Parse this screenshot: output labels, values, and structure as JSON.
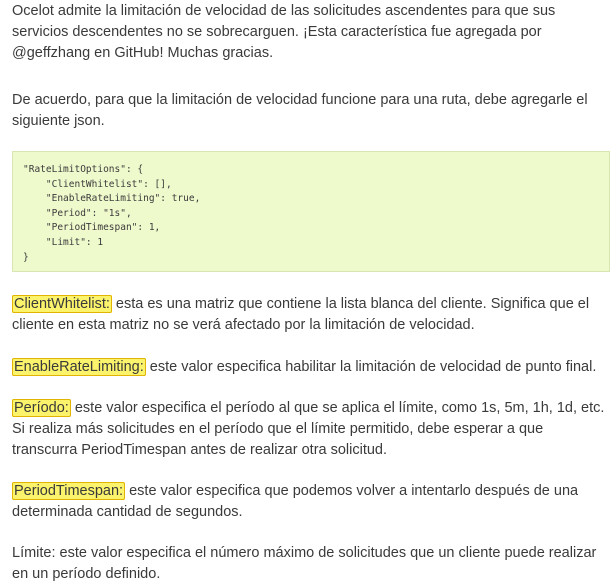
{
  "intro": "Ocelot admite la limitación de velocidad de las solicitudes ascendentes para que sus servicios descendentes no se sobrecarguen. ¡Esta característica fue agregada por @geffzhang en GitHub! Muchas gracias.",
  "instruction": "De acuerdo, para que la limitación de velocidad funcione para una ruta, debe agregarle el siguiente json.",
  "code_lines": [
    "\"RateLimitOptions\": {",
    "    \"ClientWhitelist\": [],",
    "    \"EnableRateLimiting\": true,",
    "    \"Period\": \"1s\",",
    "    \"PeriodTimespan\": 1,",
    "    \"Limit\": 1",
    "}"
  ],
  "definitions": [
    {
      "term": "ClientWhitelist:",
      "text": " esta es una matriz que contiene la lista blanca del cliente. Significa que el cliente en esta matriz no se verá afectado por la limitación de velocidad."
    },
    {
      "term": "EnableRateLimiting:",
      "text": " este valor especifica habilitar la limitación de velocidad de punto final."
    },
    {
      "term": "Período:",
      "text": " este valor especifica el período al que se aplica el límite, como 1s, 5m, 1h, 1d, etc. Si realiza más solicitudes en el período que el límite permitido, debe esperar a que transcurra PeriodTimespan antes de realizar otra solicitud."
    },
    {
      "term": "PeriodTimespan:",
      "text": " este valor especifica que podemos volver a intentarlo después de una determinada cantidad de segundos."
    }
  ],
  "limit_text": "Límite: este valor especifica el número máximo de solicitudes que un cliente puede realizar en un período definido."
}
